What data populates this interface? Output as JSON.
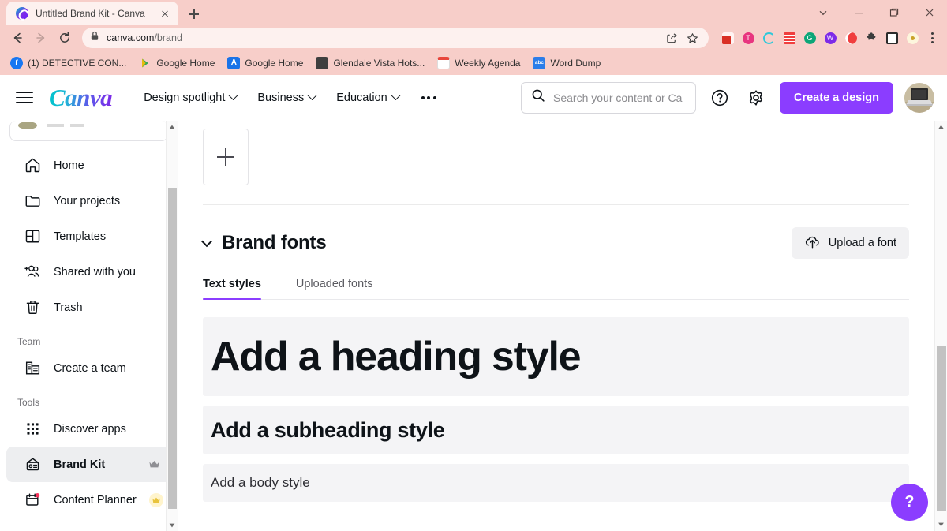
{
  "browser": {
    "tab": {
      "title": "Untitled Brand Kit - Canva",
      "favicon": "canva-icon",
      "close": "close-icon"
    },
    "new_tab": "new-tab-icon",
    "window_controls": [
      "tab-search-chevron-icon",
      "minimize-icon",
      "maximize-icon",
      "close-window-icon"
    ],
    "nav": {
      "back": "back-arrow-icon",
      "forward": "forward-arrow-icon",
      "reload": "reload-icon"
    },
    "omnibox": {
      "lock": "lock-icon",
      "domain": "canva.com",
      "path": "/brand",
      "share": "share-icon",
      "bookmark": "star-icon"
    },
    "extensions": [
      {
        "name": "red-book-extension",
        "color": "#e03131"
      },
      {
        "name": "pink-circle-extension",
        "color": "#e8357f"
      },
      {
        "name": "cyan-c-extension",
        "color": "#2ec8da"
      },
      {
        "name": "red-lines-extension",
        "color": "#f03e3e"
      },
      {
        "name": "green-circle-extension",
        "color": "#0ca678"
      },
      {
        "name": "purple-w-extension",
        "color": "#7d2ae8"
      },
      {
        "name": "orange-circle-extension",
        "color": "#f03e3e"
      },
      {
        "name": "puzzle-extension",
        "color": "#3c3c3c"
      },
      {
        "name": "square-extension",
        "color": "#2b2b2b"
      },
      {
        "name": "profile-extension",
        "color": "#f5e3a8"
      }
    ],
    "menu": "kebab-menu-icon",
    "bookmarks": [
      {
        "label": "(1) DETECTIVE CON...",
        "icon": "facebook-icon",
        "color": "#1877f2"
      },
      {
        "label": "Google Home",
        "icon": "play-store-icon",
        "color": "#34a853"
      },
      {
        "label": "Google Home",
        "icon": "appstore-icon",
        "color": "#1a73e8"
      },
      {
        "label": "Glendale Vista Hots...",
        "icon": "photo-icon",
        "color": "#6b6b6b"
      },
      {
        "label": "Weekly Agenda",
        "icon": "calendar-icon",
        "color": "#e8463c"
      },
      {
        "label": "Word Dump",
        "icon": "abc-icon",
        "color": "#2b7de9"
      }
    ]
  },
  "header": {
    "menu_button": "hamburger-menu-icon",
    "logo": "Canva",
    "nav": [
      {
        "label": "Design spotlight",
        "caret": true
      },
      {
        "label": "Business",
        "caret": true
      },
      {
        "label": "Education",
        "caret": true
      }
    ],
    "more": "more-dots-icon",
    "search": {
      "placeholder": "Search your content or Ca",
      "icon": "search-icon"
    },
    "help_icon": "help-circle-icon",
    "settings_icon": "gear-icon",
    "cta_label": "Create a design",
    "avatar": "user-avatar"
  },
  "sidebar": {
    "items": [
      {
        "label": "Home",
        "icon": "home-icon",
        "active": false
      },
      {
        "label": "Your projects",
        "icon": "folder-icon",
        "active": false
      },
      {
        "label": "Templates",
        "icon": "templates-icon",
        "active": false
      },
      {
        "label": "Shared with you",
        "icon": "shared-users-icon",
        "active": false
      },
      {
        "label": "Trash",
        "icon": "trash-icon",
        "active": false
      }
    ],
    "team_section_label": "Team",
    "team_items": [
      {
        "label": "Create a team",
        "icon": "create-team-icon"
      }
    ],
    "tools_section_label": "Tools",
    "tools_items": [
      {
        "label": "Discover apps",
        "icon": "apps-grid-icon",
        "active": false,
        "badge": null
      },
      {
        "label": "Brand Kit",
        "icon": "brand-kit-icon",
        "active": true,
        "badge": "crown-icon"
      },
      {
        "label": "Content Planner",
        "icon": "content-planner-icon",
        "active": false,
        "badge": "crown-gold-icon"
      }
    ]
  },
  "main": {
    "add_box": "add-plus-icon",
    "section": {
      "title": "Brand fonts",
      "collapse_icon": "chevron-down-icon",
      "upload_button": {
        "label": "Upload a font",
        "icon": "upload-cloud-icon"
      }
    },
    "tabs": [
      {
        "label": "Text styles",
        "active": true
      },
      {
        "label": "Uploaded fonts",
        "active": false
      }
    ],
    "text_styles": [
      {
        "label": "Add a heading style",
        "kind": "heading"
      },
      {
        "label": "Add a subheading style",
        "kind": "subheading"
      },
      {
        "label": "Add a body style",
        "kind": "body"
      }
    ],
    "help_fab": "?"
  },
  "colors": {
    "browser_theme": "#f7cec9",
    "omnibox_bg": "#fdf1ef",
    "canva_purple": "#8b3dff",
    "active_tab_underline": "#8b3dff",
    "style_row_bg": "#f4f4f6",
    "sidebar_active_bg": "#edeef0"
  }
}
